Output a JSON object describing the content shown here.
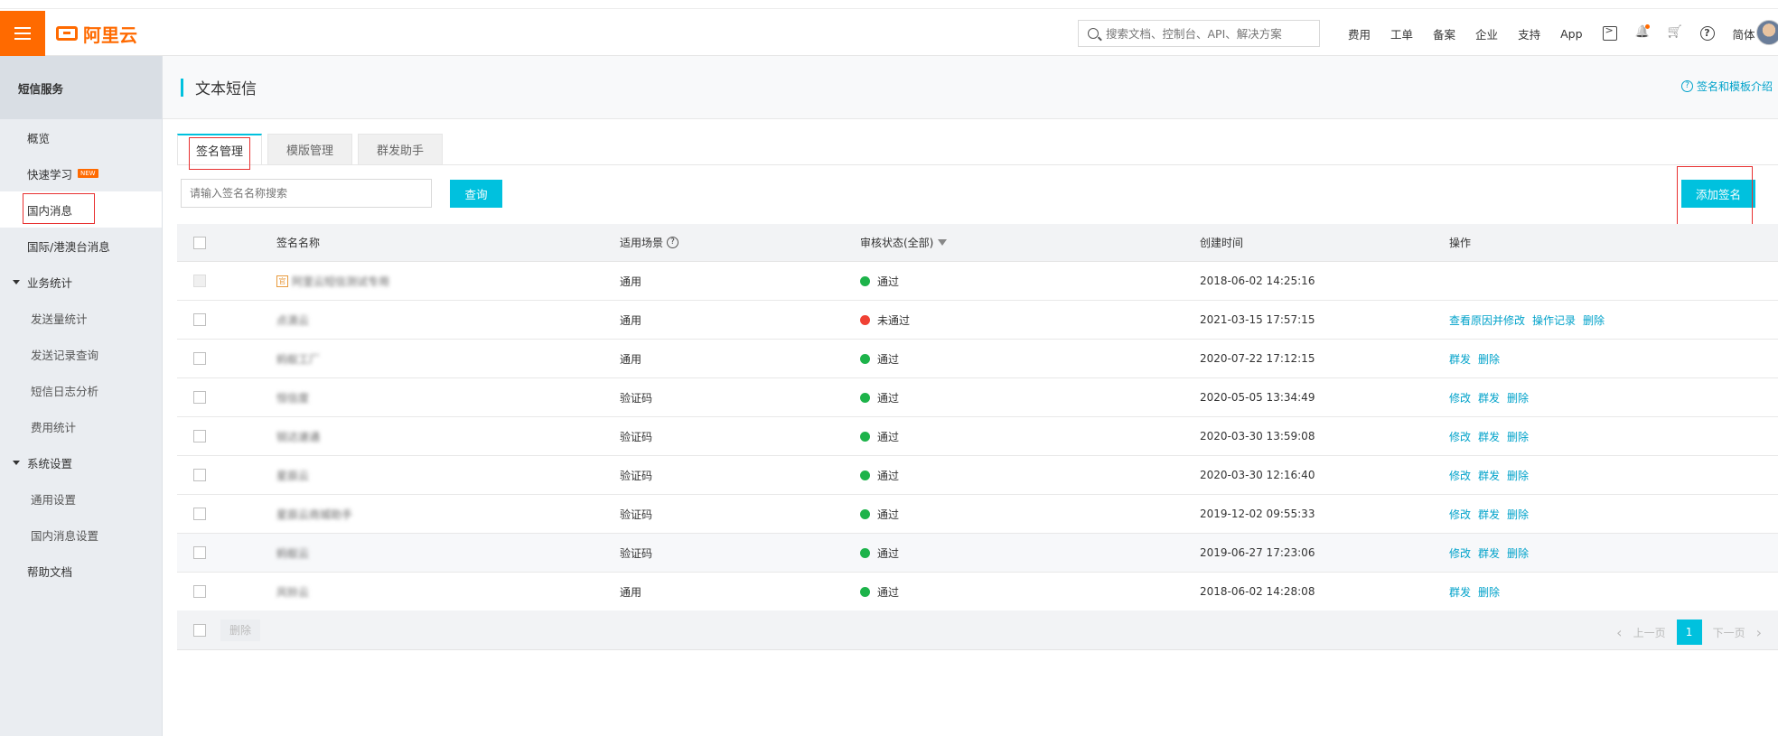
{
  "topbar": {
    "logo_text": "阿里云",
    "search_placeholder": "搜索文档、控制台、API、解决方案",
    "links": [
      "费用",
      "工单",
      "备案",
      "企业",
      "支持",
      "App"
    ],
    "lang": "简体"
  },
  "sidebar": {
    "title": "短信服务",
    "items": [
      {
        "label": "概览",
        "type": "item"
      },
      {
        "label": "快速学习",
        "type": "item",
        "badge": "NEW"
      },
      {
        "label": "国内消息",
        "type": "item",
        "active": true
      },
      {
        "label": "国际/港澳台消息",
        "type": "item"
      },
      {
        "label": "业务统计",
        "type": "group"
      },
      {
        "label": "发送量统计",
        "type": "sub"
      },
      {
        "label": "发送记录查询",
        "type": "sub"
      },
      {
        "label": "短信日志分析",
        "type": "sub"
      },
      {
        "label": "费用统计",
        "type": "sub"
      },
      {
        "label": "系统设置",
        "type": "group"
      },
      {
        "label": "通用设置",
        "type": "sub"
      },
      {
        "label": "国内消息设置",
        "type": "sub"
      },
      {
        "label": "帮助文档",
        "type": "item"
      }
    ]
  },
  "page": {
    "title": "文本短信",
    "intro_link": "签名和模板介绍",
    "tabs": [
      "签名管理",
      "模版管理",
      "群发助手"
    ],
    "search_placeholder": "请输入签名名称搜索",
    "query_label": "查询",
    "add_label": "添加签名"
  },
  "table": {
    "headers": {
      "name": "签名名称",
      "scene": "适用场景",
      "status": "审核状态(全部)",
      "created": "创建时间",
      "ops": "操作"
    },
    "rows": [
      {
        "name": "阿里云短信测试专用",
        "tag": "官",
        "scene": "通用",
        "status": "通过",
        "status_color": "#1db34a",
        "created": "2018-06-02 14:25:16",
        "ops": [],
        "disabled": true
      },
      {
        "name": "点滴云",
        "scene": "通用",
        "status": "未通过",
        "status_color": "#f04134",
        "created": "2021-03-15 17:57:15",
        "ops": [
          "查看原因并修改",
          "操作记录",
          "删除"
        ]
      },
      {
        "name": "蚂蚁工厂",
        "scene": "通用",
        "status": "通过",
        "status_color": "#1db34a",
        "created": "2020-07-22 17:12:15",
        "ops": [
          "群发",
          "删除"
        ]
      },
      {
        "name": "恒信度",
        "scene": "验证码",
        "status": "通过",
        "status_color": "#1db34a",
        "created": "2020-05-05 13:34:49",
        "ops": [
          "修改",
          "群发",
          "删除"
        ]
      },
      {
        "name": "锐达速通",
        "scene": "验证码",
        "status": "通过",
        "status_color": "#1db34a",
        "created": "2020-03-30 13:59:08",
        "ops": [
          "修改",
          "群发",
          "删除"
        ]
      },
      {
        "name": "星辰云",
        "scene": "验证码",
        "status": "通过",
        "status_color": "#1db34a",
        "created": "2020-03-30 12:16:40",
        "ops": [
          "修改",
          "群发",
          "删除"
        ]
      },
      {
        "name": "星辰云商城助手",
        "scene": "验证码",
        "status": "通过",
        "status_color": "#1db34a",
        "created": "2019-12-02 09:55:33",
        "ops": [
          "修改",
          "群发",
          "删除"
        ]
      },
      {
        "name": "蚂蚁云",
        "scene": "验证码",
        "status": "通过",
        "status_color": "#1db34a",
        "created": "2019-06-27 17:23:06",
        "ops": [
          "修改",
          "群发",
          "删除"
        ],
        "highlight": true
      },
      {
        "name": "风铃云",
        "scene": "通用",
        "status": "通过",
        "status_color": "#1db34a",
        "created": "2018-06-02 14:28:08",
        "ops": [
          "群发",
          "删除"
        ]
      }
    ]
  },
  "footer": {
    "delete_label": "删除",
    "prev_label": "上一页",
    "next_label": "下一页",
    "current_page": "1"
  }
}
